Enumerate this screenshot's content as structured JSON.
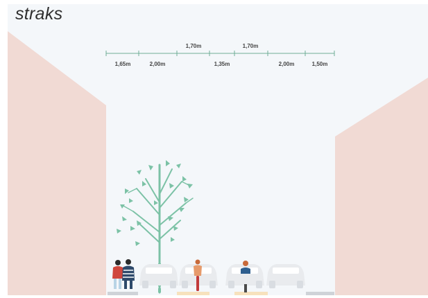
{
  "title": "straks",
  "dimensions": {
    "lower": [
      "1,65m",
      "2,00m",
      "1,35m",
      "2,00m",
      "1,50m"
    ],
    "upper": [
      "1,70m",
      "1,70m"
    ]
  },
  "colors": {
    "background": "#f4f7fa",
    "building": "#f1dad4",
    "tree": "#7cc2a6",
    "dimension_line": "#6fae97",
    "car": "#e9ebee",
    "bike_lane": "#f7e2bd",
    "sidewalk": "#cfd3d8"
  }
}
